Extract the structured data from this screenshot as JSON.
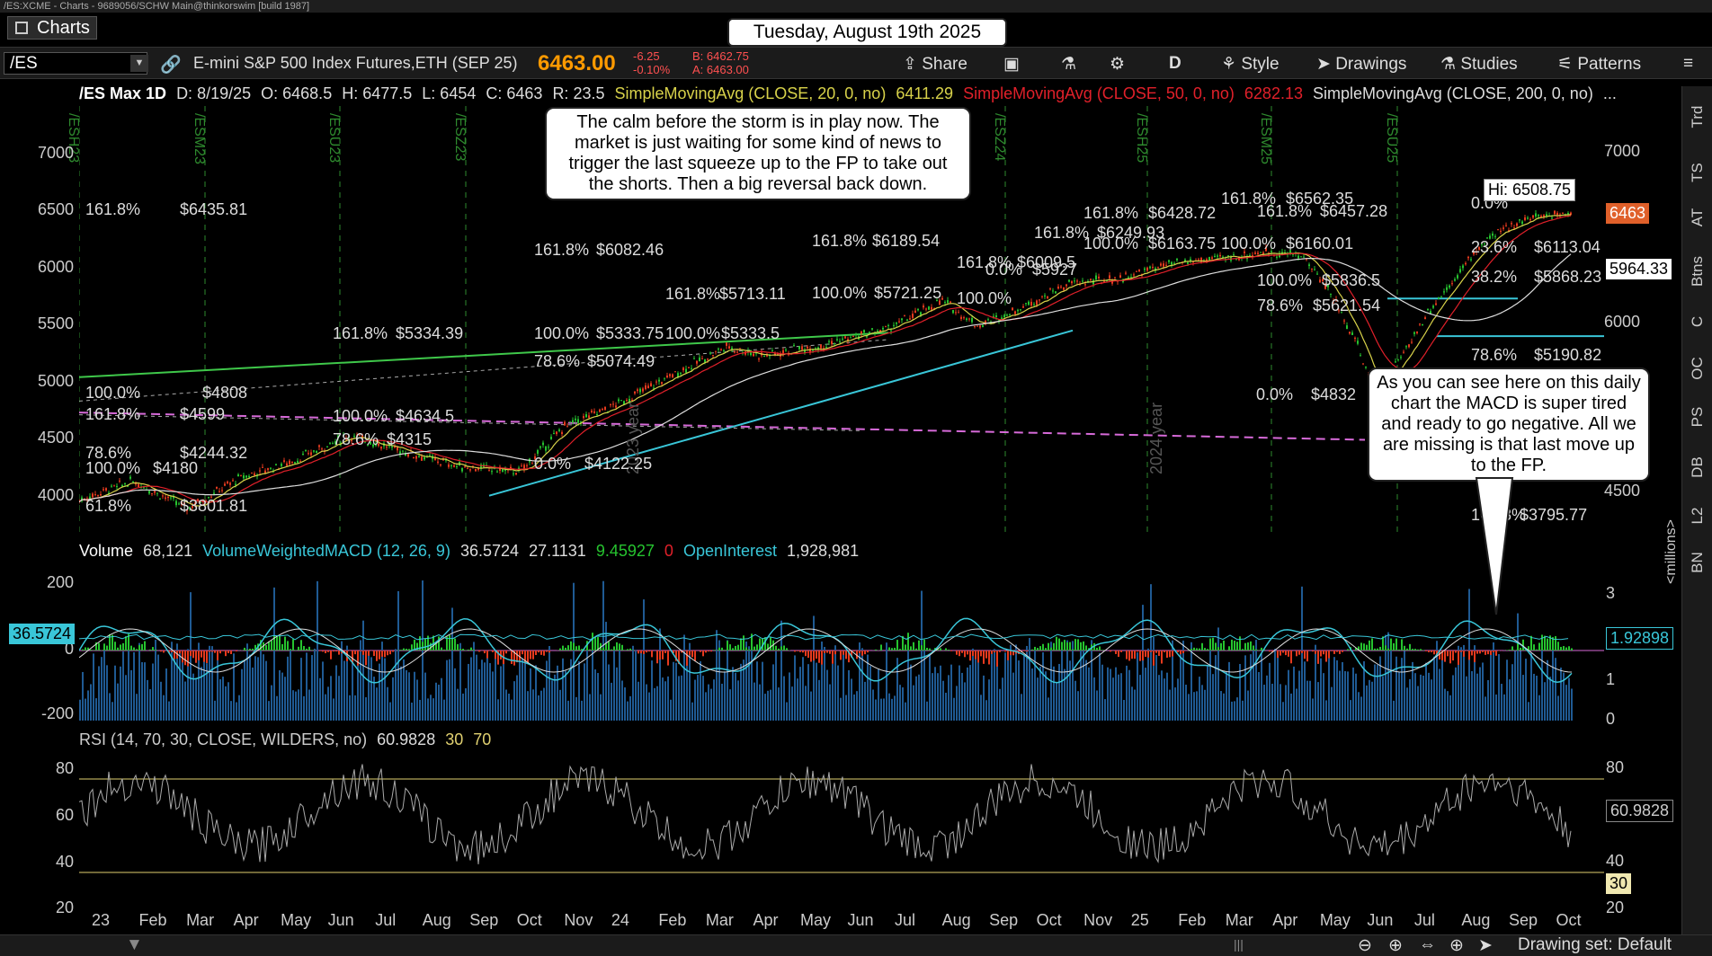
{
  "window": {
    "title": "/ES:XCME - Charts - 9689056/SCHW Main@thinkorswim [build 1987]"
  },
  "tab": {
    "label": "Charts"
  },
  "banner": {
    "date": "Tuesday, August 19th 2025"
  },
  "toolbar": {
    "symbol": "/ES",
    "description": "E-mini S&P 500 Index Futures,ETH (SEP 25)",
    "last": "6463.00",
    "change": "-6.25",
    "change_pct": "-0.10%",
    "bid": "B: 6462.75",
    "ask": "A: 6463.00",
    "share": "Share",
    "timeframe": "D",
    "style": "Style",
    "drawings": "Drawings",
    "studies": "Studies",
    "patterns": "Patterns"
  },
  "info": {
    "title": "/ES Max 1D",
    "date": "D: 8/19/25",
    "open": "O: 6468.5",
    "high": "H: 6477.5",
    "low": "L: 6454",
    "close": "C: 6463",
    "range": "R: 23.5",
    "sma20_label": "SimpleMovingAvg (CLOSE, 20, 0, no)",
    "sma20_value": "6411.29",
    "sma50_label": "SimpleMovingAvg (CLOSE, 50, 0, no)",
    "sma50_value": "6282.13",
    "sma200_label": "SimpleMovingAvg (CLOSE, 200, 0, no)",
    "more": "..."
  },
  "annotations": {
    "top": "The calm before the storm is in play now.  The market is just waiting for some kind of news to trigger the last squeeze up to the FP to take out the shorts.  Then a big reversal back down.",
    "right": "As you can see here on this daily chart the MACD is super tired and ready to go negative.  All we are missing is that last move up to the FP."
  },
  "price_axis": {
    "ticks": [
      "7000",
      "6500",
      "6000",
      "5500",
      "5000",
      "4500",
      "4000"
    ],
    "last_tag": "6463",
    "level_tag": "5964.33",
    "high_tag": "Hi: 6508.75"
  },
  "contract_marks": [
    "/ESH23",
    "/ESM23",
    "/ESU23",
    "/ESZ23",
    "/ESZ24",
    "/ESH25",
    "/ESM25",
    "/ESU25"
  ],
  "year_marks": [
    "2023 year",
    "2024 year"
  ],
  "fib_labels": [
    "161.8%",
    "$6435.81",
    "100.0%",
    "$4808",
    "161.8%",
    "$4599",
    "78.6%",
    "$4244.32",
    "100.0%",
    "$4180",
    "61.8%",
    "$3801.81",
    "161.8%",
    "$5334.39",
    "100.0%",
    "$4634.5",
    "78.6%",
    "$4315",
    "161.8%",
    "$6082.46",
    "100.0%",
    "$5333.75",
    "78.6%",
    "$5074.49",
    "0.0%",
    "$4122.25",
    "161.8%",
    "$5713.11",
    "100.0%",
    "$5333.5",
    "161.8%",
    "$6189.54",
    "100.0%",
    "$5721.25",
    "161.8%",
    "$6009.5",
    "100.0%",
    "0.0%",
    "$5927",
    "161.8%",
    "$6428.72",
    "161.8%",
    "$6249.93",
    "100.0%",
    "$6163.75",
    "161.8%",
    "$6562.35",
    "161.8%",
    "$6457.28",
    "100.0%",
    "$6160.01",
    "100.0%",
    "$5836.5",
    "78.6%",
    "$5621.54",
    "0.0%",
    "$4832",
    "23.6%",
    "$6113.04",
    "38.2%",
    "$5868.23",
    "78.6%",
    "$5190.82",
    "161.8%",
    "$3795.77",
    "0.0%"
  ],
  "macd": {
    "volume_label": "Volume",
    "volume_value": "68,121",
    "study_label": "VolumeWeightedMACD (12, 26, 9)",
    "value": "36.5724",
    "avg": "27.1131",
    "diff": "9.45927",
    "zero": "0",
    "oi_label": "OpenInterest",
    "oi_value": "1,928,981",
    "left_ticks": [
      "200",
      "0",
      "-200"
    ],
    "right_ticks": [
      "3",
      "2",
      "1",
      "0"
    ],
    "value_tag": "36.5724",
    "oi_tag": "1.92898",
    "units": "<millions>"
  },
  "rsi": {
    "label": "RSI (14, 70, 30, CLOSE, WILDERS, no)",
    "value": "60.9828",
    "os": "30",
    "ob": "70",
    "left_ticks": [
      "80",
      "60",
      "40",
      "20"
    ],
    "right_ticks": [
      "80",
      "40",
      "20"
    ],
    "value_tag": "60.9828",
    "os_tag": "30"
  },
  "xaxis": [
    "23",
    "Feb",
    "Mar",
    "Apr",
    "May",
    "Jun",
    "Jul",
    "Aug",
    "Sep",
    "Oct",
    "Nov",
    "24",
    "Feb",
    "Mar",
    "Apr",
    "May",
    "Jun",
    "Jul",
    "Aug",
    "Sep",
    "Oct",
    "Nov",
    "25",
    "Feb",
    "Mar",
    "Apr",
    "May",
    "Jun",
    "Jul",
    "Aug",
    "Sep",
    "Oct"
  ],
  "side_tabs": [
    "Trd",
    "TS",
    "AT",
    "Btns",
    "C",
    "OC",
    "PS",
    "DB",
    "L2",
    "BN"
  ],
  "bottom": {
    "drawing_set": "Drawing set: Default"
  },
  "colors": {
    "price_up": "#26c32f",
    "price_down": "#e63a1e",
    "sma20": "#d8d24a",
    "sma50": "#e0202a",
    "sma200": "#dddddd",
    "macd": "#39c6d8",
    "accent": "#ff9a00"
  }
}
